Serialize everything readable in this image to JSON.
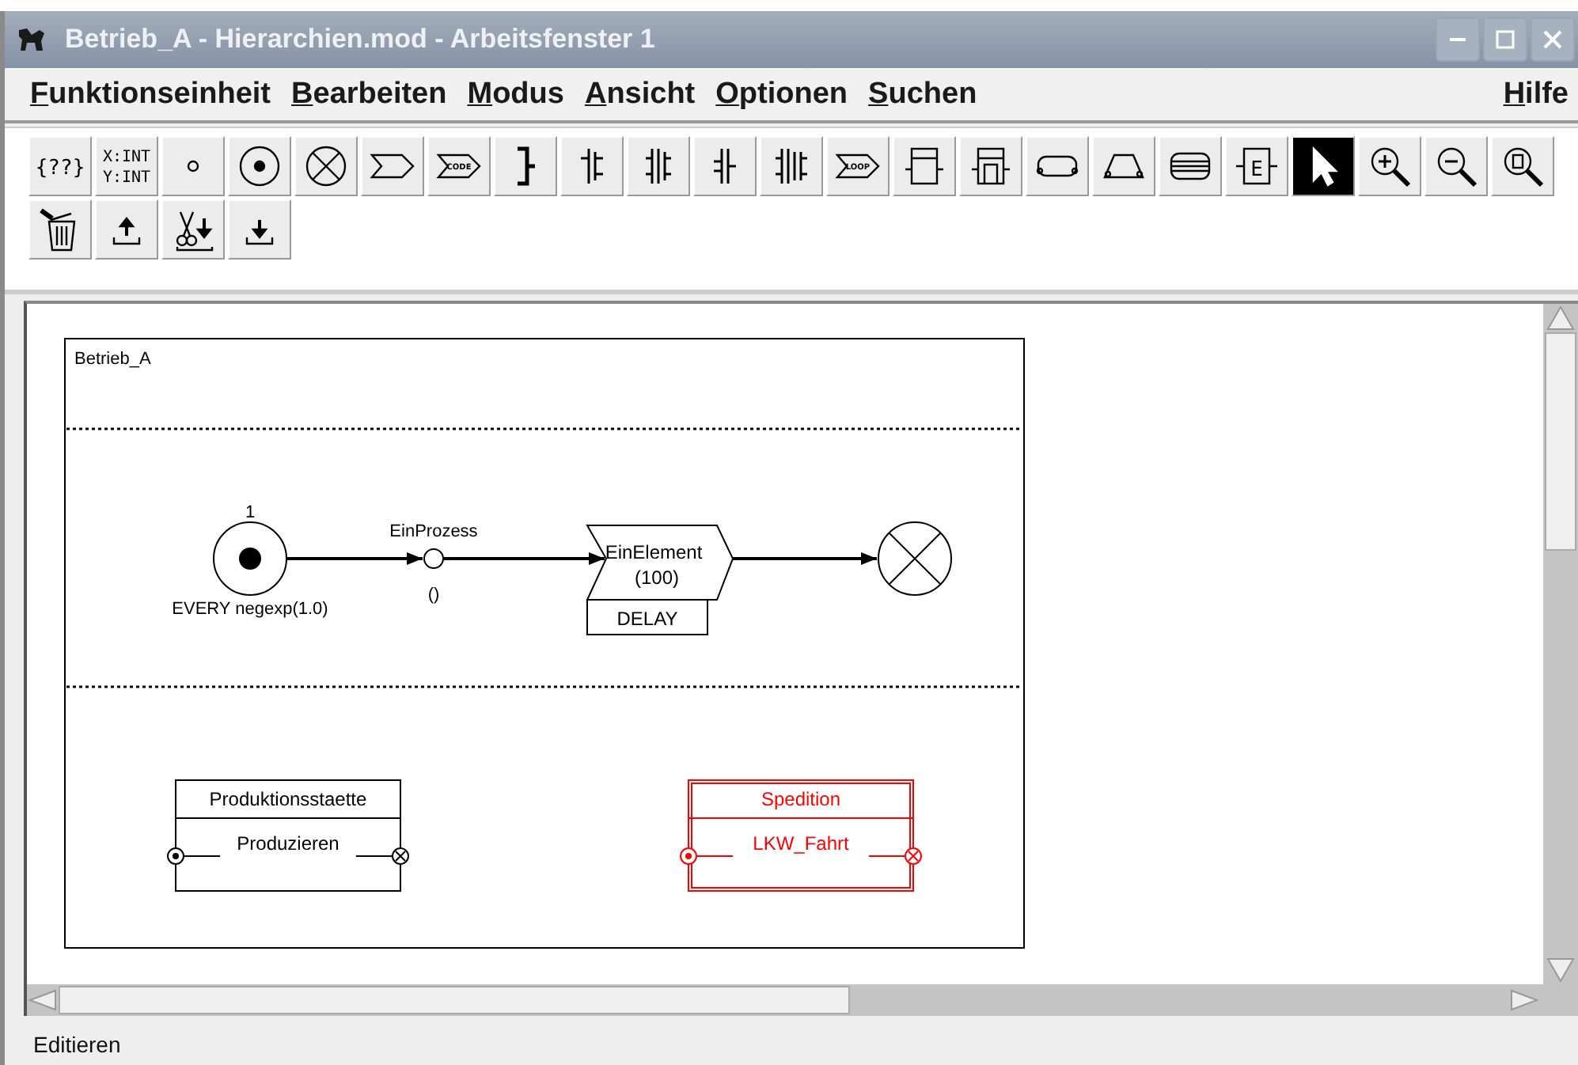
{
  "window": {
    "title": "Betrieb_A - Hierarchien.mod - Arbeitsfenster 1"
  },
  "menu": [
    {
      "key": "F",
      "rest": "unktionseinheit"
    },
    {
      "key": "B",
      "rest": "earbeiten"
    },
    {
      "key": "M",
      "rest": "odus"
    },
    {
      "key": "A",
      "rest": "nsicht"
    },
    {
      "key": "O",
      "rest": "ptionen"
    },
    {
      "key": "S",
      "rest": "uchen"
    }
  ],
  "help_menu": {
    "key": "H",
    "rest": "ilfe"
  },
  "toolbar": [
    [
      {
        "kind": "braces",
        "label": "{??}",
        "selected": false
      },
      {
        "kind": "xyint",
        "lines": [
          "X:INT",
          "Y:INT"
        ],
        "selected": false
      },
      {
        "kind": "small-circle",
        "selected": false
      },
      {
        "kind": "source",
        "selected": false
      },
      {
        "kind": "sink",
        "selected": false
      },
      {
        "kind": "process",
        "selected": false
      },
      {
        "kind": "code",
        "label": "CODE",
        "selected": false
      },
      {
        "kind": "bracket",
        "selected": false
      },
      {
        "kind": "split1",
        "selected": false
      },
      {
        "kind": "split2",
        "selected": false
      },
      {
        "kind": "split3",
        "selected": false
      },
      {
        "kind": "split4",
        "selected": false
      },
      {
        "kind": "loop",
        "label": "LOOP",
        "selected": false
      },
      {
        "kind": "box1",
        "selected": false
      },
      {
        "kind": "box2",
        "selected": false
      },
      {
        "kind": "rounded",
        "selected": false
      },
      {
        "kind": "trapezoid",
        "selected": false
      },
      {
        "kind": "stack",
        "selected": false
      },
      {
        "kind": "ebox",
        "label": "E",
        "selected": false
      },
      {
        "kind": "pointer",
        "selected": true
      },
      {
        "kind": "zoom-in",
        "selected": false
      },
      {
        "kind": "zoom-out",
        "selected": false
      },
      {
        "kind": "zoom-fit",
        "selected": false
      }
    ],
    [
      {
        "kind": "trash",
        "selected": false
      },
      {
        "kind": "upload",
        "selected": false
      },
      {
        "kind": "cut-down",
        "selected": false
      },
      {
        "kind": "download",
        "selected": false
      }
    ]
  ],
  "diagram": {
    "title": "Betrieb_A",
    "source": {
      "count": "1",
      "label": "EVERY negexp(1.0)"
    },
    "process": {
      "name": "EinProzess",
      "args": "()"
    },
    "element": {
      "name": "EinElement",
      "capacity": "(100)",
      "type": "DELAY"
    },
    "modules": [
      {
        "title": "Produktionsstaette",
        "process": "Produzieren",
        "selected": false
      },
      {
        "title": "Spedition",
        "process": "LKW_Fahrt",
        "selected": true
      }
    ]
  },
  "status_bar": "Editieren"
}
